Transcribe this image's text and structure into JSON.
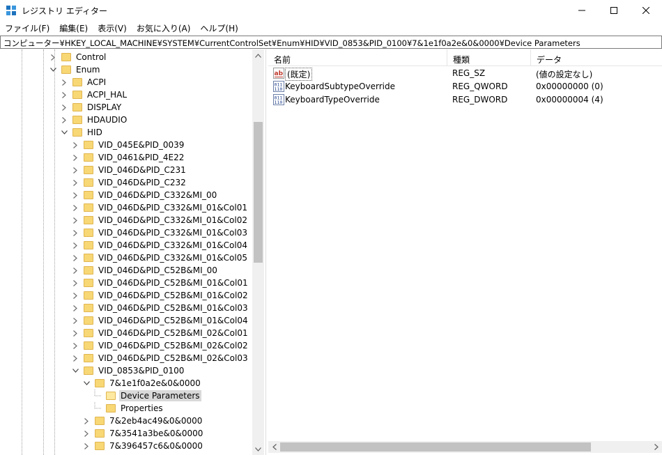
{
  "window": {
    "title": "レジストリ エディター"
  },
  "menu": [
    {
      "label": "ファイル(F)"
    },
    {
      "label": "編集(E)"
    },
    {
      "label": "表示(V)"
    },
    {
      "label": "お気に入り(A)"
    },
    {
      "label": "ヘルプ(H)"
    }
  ],
  "address": {
    "path": "コンピューター¥HKEY_LOCAL_MACHINE¥SYSTEM¥CurrentControlSet¥Enum¥HID¥VID_0853&PID_0100¥7&1e1f0a2e&0&0000¥Device Parameters"
  },
  "tree": {
    "items": [
      {
        "label": "Control",
        "depth": 0,
        "expander": "collapsed"
      },
      {
        "label": "Enum",
        "depth": 0,
        "expander": "expanded"
      },
      {
        "label": "ACPI",
        "depth": 1,
        "expander": "collapsed"
      },
      {
        "label": "ACPI_HAL",
        "depth": 1,
        "expander": "collapsed"
      },
      {
        "label": "DISPLAY",
        "depth": 1,
        "expander": "collapsed"
      },
      {
        "label": "HDAUDIO",
        "depth": 1,
        "expander": "collapsed"
      },
      {
        "label": "HID",
        "depth": 1,
        "expander": "expanded"
      },
      {
        "label": "VID_045E&PID_0039",
        "depth": 2,
        "expander": "collapsed"
      },
      {
        "label": "VID_0461&PID_4E22",
        "depth": 2,
        "expander": "collapsed"
      },
      {
        "label": "VID_046D&PID_C231",
        "depth": 2,
        "expander": "collapsed"
      },
      {
        "label": "VID_046D&PID_C232",
        "depth": 2,
        "expander": "collapsed"
      },
      {
        "label": "VID_046D&PID_C332&MI_00",
        "depth": 2,
        "expander": "collapsed"
      },
      {
        "label": "VID_046D&PID_C332&MI_01&Col01",
        "depth": 2,
        "expander": "collapsed"
      },
      {
        "label": "VID_046D&PID_C332&MI_01&Col02",
        "depth": 2,
        "expander": "collapsed"
      },
      {
        "label": "VID_046D&PID_C332&MI_01&Col03",
        "depth": 2,
        "expander": "collapsed"
      },
      {
        "label": "VID_046D&PID_C332&MI_01&Col04",
        "depth": 2,
        "expander": "collapsed"
      },
      {
        "label": "VID_046D&PID_C332&MI_01&Col05",
        "depth": 2,
        "expander": "collapsed"
      },
      {
        "label": "VID_046D&PID_C52B&MI_00",
        "depth": 2,
        "expander": "collapsed"
      },
      {
        "label": "VID_046D&PID_C52B&MI_01&Col01",
        "depth": 2,
        "expander": "collapsed"
      },
      {
        "label": "VID_046D&PID_C52B&MI_01&Col02",
        "depth": 2,
        "expander": "collapsed"
      },
      {
        "label": "VID_046D&PID_C52B&MI_01&Col03",
        "depth": 2,
        "expander": "collapsed"
      },
      {
        "label": "VID_046D&PID_C52B&MI_01&Col04",
        "depth": 2,
        "expander": "collapsed"
      },
      {
        "label": "VID_046D&PID_C52B&MI_02&Col01",
        "depth": 2,
        "expander": "collapsed"
      },
      {
        "label": "VID_046D&PID_C52B&MI_02&Col02",
        "depth": 2,
        "expander": "collapsed"
      },
      {
        "label": "VID_046D&PID_C52B&MI_02&Col03",
        "depth": 2,
        "expander": "collapsed"
      },
      {
        "label": "VID_0853&PID_0100",
        "depth": 2,
        "expander": "expanded"
      },
      {
        "label": "7&1e1f0a2e&0&0000",
        "depth": 3,
        "expander": "expanded"
      },
      {
        "label": "Device Parameters",
        "depth": 4,
        "expander": "none",
        "selected": true
      },
      {
        "label": "Properties",
        "depth": 4,
        "expander": "none"
      },
      {
        "label": "7&2eb4ac49&0&0000",
        "depth": 3,
        "expander": "collapsed"
      },
      {
        "label": "7&3541a3be&0&0000",
        "depth": 3,
        "expander": "collapsed"
      },
      {
        "label": "7&396457c6&0&0000",
        "depth": 3,
        "expander": "collapsed"
      }
    ]
  },
  "values": {
    "headers": {
      "name": "名前",
      "type": "種類",
      "data": "データ"
    },
    "rows": [
      {
        "name": "(既定)",
        "type": "REG_SZ",
        "data": "(値の設定なし)",
        "icon": "string-value-icon",
        "default": true
      },
      {
        "name": "KeyboardSubtypeOverride",
        "type": "REG_QWORD",
        "data": "0x00000000 (0)",
        "icon": "binary-value-icon"
      },
      {
        "name": "KeyboardTypeOverride",
        "type": "REG_DWORD",
        "data": "0x00000004 (4)",
        "icon": "binary-value-icon"
      }
    ]
  },
  "colors": {
    "folder": "#f8d775",
    "selection": "#d9d9d9"
  }
}
